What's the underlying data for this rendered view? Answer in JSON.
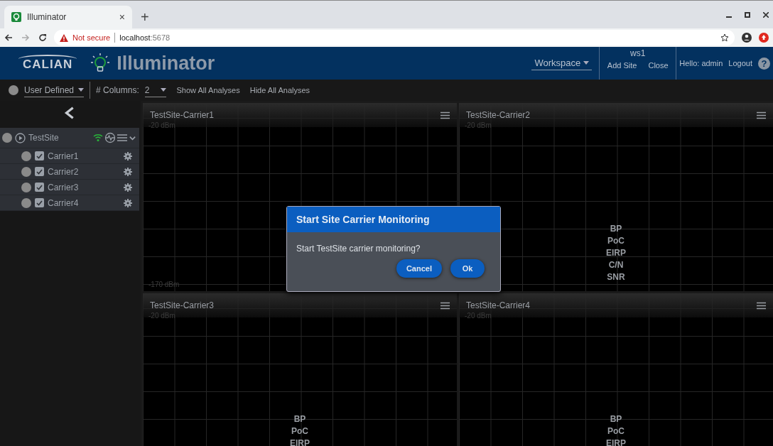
{
  "browser": {
    "tab": {
      "title": "Illuminator",
      "close": "×"
    },
    "new_tab": "+",
    "back_disabled": false,
    "forward_disabled": true,
    "security": "Not secure",
    "url_host": "localhost",
    "url_port": ":5678"
  },
  "header": {
    "logo": "CALIAN",
    "title": "Illuminator",
    "workspace": "Workspace",
    "ws_name": "ws1",
    "add_site": "Add Site",
    "close": "Close",
    "greeting": "Hello: admin",
    "logout": "Logout",
    "help": "?"
  },
  "toolbar": {
    "layout": "User Defined",
    "columns_label": "# Columns:",
    "columns_value": "2",
    "show_all": "Show All Analyses",
    "hide_all": "Hide All Analyses"
  },
  "sidebar": {
    "site": {
      "name": "TestSite",
      "children": [
        {
          "name": "Carrier1",
          "checked": true
        },
        {
          "name": "Carrier2",
          "checked": true
        },
        {
          "name": "Carrier3",
          "checked": true
        },
        {
          "name": "Carrier4",
          "checked": true
        }
      ]
    }
  },
  "panels": [
    {
      "title": "TestSite-Carrier1",
      "top_label": "-20 dBm",
      "bottom_label": "-170 dBm"
    },
    {
      "title": "TestSite-Carrier2",
      "top_label": "-20 dBm",
      "metrics": [
        "BP",
        "PoC",
        "EIRP",
        "C/N",
        "SNR"
      ]
    },
    {
      "title": "TestSite-Carrier3",
      "top_label": "-20 dBm",
      "metrics": [
        "BP",
        "PoC",
        "EIRP"
      ]
    },
    {
      "title": "TestSite-Carrier4",
      "top_label": "-20 dBm",
      "metrics": [
        "BP",
        "PoC",
        "EIRP"
      ]
    }
  ],
  "dialog": {
    "title": "Start Site Carrier Monitoring",
    "message": "Start TestSite carrier monitoring?",
    "buttons": [
      "Cancel",
      "Ok"
    ]
  }
}
